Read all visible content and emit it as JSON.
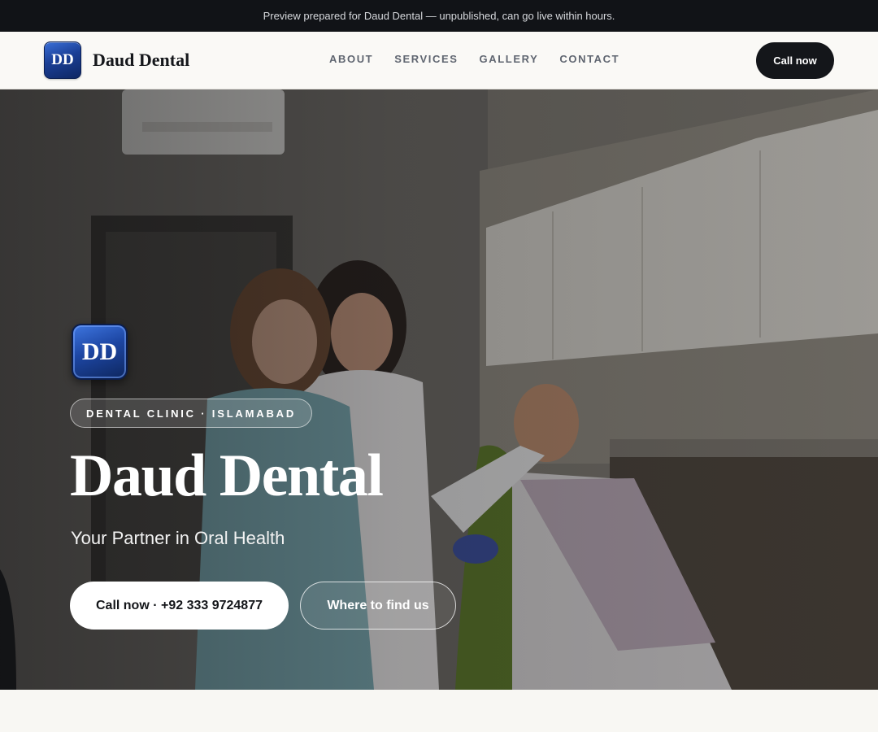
{
  "preview_banner": "Preview prepared for Daud Dental — unpublished, can go live within hours.",
  "header": {
    "logo_text": "DD",
    "brand": "Daud Dental",
    "nav": [
      "ABOUT",
      "SERVICES",
      "GALLERY",
      "CONTACT"
    ],
    "cta": "Call now"
  },
  "hero": {
    "logo_text": "DD",
    "eyebrow": "DENTAL CLINIC · ISLAMABAD",
    "title": "Daud Dental",
    "subtitle": "Your Partner in Oral Health",
    "primary_button": "Call now · +92 333 9724877",
    "secondary_button": "Where to find us"
  },
  "colors": {
    "topbar_bg": "#111317",
    "header_bg": "#faf9f6",
    "brand_blue": "#1d46a3",
    "dark_button": "#14161a"
  }
}
